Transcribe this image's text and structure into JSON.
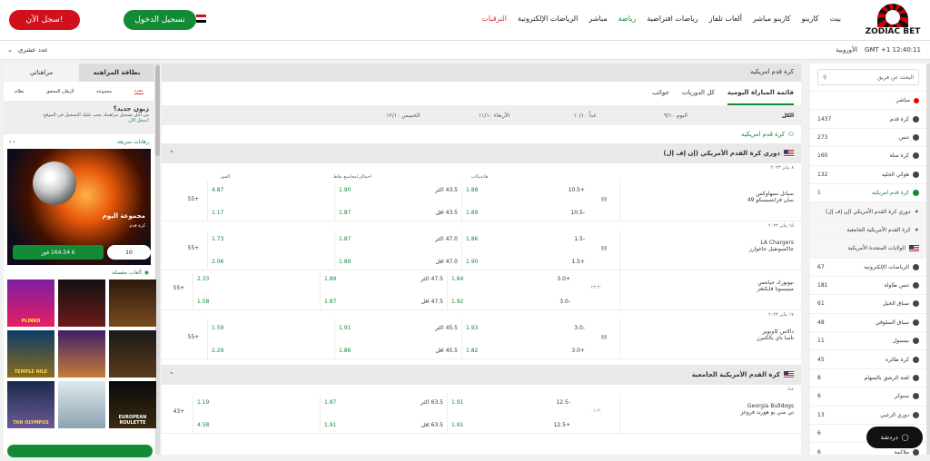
{
  "brand": {
    "logo_text": "ZODIAC BET"
  },
  "topnav": [
    "بيت",
    "كازينو",
    "كازينو مباشر",
    "ألعاب تلفاز",
    "رياضات افتراضية",
    "رياضة",
    "مباشر",
    "الرياضات الإلكترونية",
    "الترقيات"
  ],
  "buttons": {
    "login": "تسجيل الدخول",
    "register": "سجل الآن!"
  },
  "subbar": {
    "region": "الأوروبية",
    "time": "GMT +1 12:40:11",
    "odds_format": "عدد عشري"
  },
  "sidebar": {
    "search": "البحث عن فريق",
    "items": [
      {
        "label": "مباشر",
        "count": ""
      },
      {
        "label": "كرة قدم",
        "count": "1437"
      },
      {
        "label": "تنس",
        "count": "273"
      },
      {
        "label": "كرة سلة",
        "count": "160"
      },
      {
        "label": "هوكي الجليد",
        "count": "132"
      },
      {
        "label": "كرة قدم امريكيه",
        "count": "5"
      },
      {
        "label": "دوري كرة القدم الأمريكي (إن إف إل)",
        "count": ""
      },
      {
        "label": "كرة القدم الأمريكية الجامعية",
        "count": ""
      },
      {
        "label": "الولايات المتحدة الأمريكية",
        "count": ""
      },
      {
        "label": "الرياضات الإلكترونية",
        "count": "67"
      },
      {
        "label": "تنس طاولة",
        "count": "181"
      },
      {
        "label": "سباق الخيل",
        "count": "61"
      },
      {
        "label": "سباق السلوقي",
        "count": "48"
      },
      {
        "label": "بيسبول",
        "count": "11"
      },
      {
        "label": "كرة طائره",
        "count": "45"
      },
      {
        "label": "لعبة الرشق بالسهام",
        "count": "8"
      },
      {
        "label": "سنوكر",
        "count": "6"
      },
      {
        "label": "دوري الرغبي",
        "count": "13"
      },
      {
        "label": "",
        "count": "6"
      },
      {
        "label": "ملاكمة",
        "count": "6"
      }
    ]
  },
  "main": {
    "header": "كرة قدم امريكيه",
    "tabs": [
      "قائمة المباراة اليومية",
      "كل الدوريات",
      "جوائب"
    ],
    "days": [
      "الكل",
      "اليوم ٩/١٠",
      "غداً ١٠/١٠",
      "الأربعاء ١١/١٠",
      "الخميس ١٢/١٠"
    ],
    "section": "كرة قدم امريكيه",
    "col_headers": [
      "الفوز",
      "احمالي/مجاميع نقاط",
      "هانديكاب"
    ],
    "leagues": [
      {
        "name": "دوري كرة القدم الأمريكي (إن إف إل)"
      },
      {
        "name": "كرة القدم الأمريكية الجامعية"
      }
    ],
    "dates": [
      "٨ يناير ٢٠٢٣",
      "١٥ يناير ٢٠٢٣",
      "١٧ يناير ٢٠٢٣",
      "غدا"
    ],
    "matches": [
      {
        "home": "سياتل سيهاوكس",
        "away": "سان فرانسيسكو 49",
        "time": "",
        "hc1": "+10.5",
        "hc1v": "1.88",
        "hc2": "-10.5",
        "hc2v": "1.89",
        "o": "43.5 اكثر",
        "ov": "1.90",
        "u": "43.5 اقل",
        "uv": "1.87",
        "w1": "4.87",
        "w2": "1.17",
        "more": "55+"
      },
      {
        "home": "LA Chargers",
        "away": "جاكسونفيل جاغوارز",
        "time": "",
        "hc1": "-1.5",
        "hc1v": "1.86",
        "hc2": "+1.5",
        "hc2v": "1.90",
        "o": "47.0 اكثر",
        "ov": "1.87",
        "u": "47.0 اقل",
        "uv": "1.89",
        "w1": "1.73",
        "w2": "2.06",
        "more": "55+"
      },
      {
        "home": "نيويورك جيانتس",
        "away": "مينيسوتا فايكنغز",
        "time": "٢٢:٣٠",
        "hc1": "+3.0",
        "hc1v": "1.84",
        "hc2": "-3.0",
        "hc2v": "1.92",
        "o": "47.5 اكثر",
        "ov": "1.89",
        "u": "47.5 اقل",
        "uv": "1.87",
        "w1": "2.33",
        "w2": "1.58",
        "more": "55+"
      },
      {
        "home": "دالاس كاوبويز",
        "away": "تامبا باي بالكنيرز",
        "time": "",
        "hc1": "-3.0",
        "hc1v": "1.93",
        "hc2": "+3.0",
        "hc2v": "1.82",
        "o": "45.5 اكثر",
        "ov": "1.91",
        "u": "45.5 اقل",
        "uv": "1.86",
        "w1": "1.59",
        "w2": "2.29",
        "more": "55+"
      },
      {
        "home": "Georgia Bulldogs",
        "away": "تي سي يو هورند فروغز",
        "time": "٠١:٣٠",
        "hc1": "-12.5",
        "hc1v": "1.91",
        "hc2": "+12.5",
        "hc2v": "1.91",
        "o": "63.5 اكثر",
        "ov": "1.87",
        "u": "63.5 اقل",
        "uv": "1.91",
        "w1": "1.19",
        "w2": "4.58",
        "more": "43+"
      }
    ]
  },
  "rpanel": {
    "tabs": [
      "بطاقة المراهنه",
      "مراهناتي"
    ],
    "subtabs": [
      "مفرد",
      "مجموعة",
      "الرهان المحقق",
      "نظام"
    ],
    "new_title": "زبون جديد؟",
    "new_desc": "من أجل تسجيل مراهنتك يجب عليك التسجيل في الموقع",
    "new_link": "سجل الآن!",
    "quick": "رهانات سريعة",
    "banner_title": "مجموعة اليوم",
    "banner_sub": "كرة قدم",
    "bet_amount": "فوز ‎164.54 €",
    "stake": "10",
    "fav": "ألعاب مفضلة",
    "games": [
      "PLINKO",
      "",
      "",
      "TEMPLE NILE",
      "",
      "",
      "TAN OLYMPUS",
      "",
      "EUROPEAN ROULETTE"
    ]
  },
  "chat": "دردشة"
}
